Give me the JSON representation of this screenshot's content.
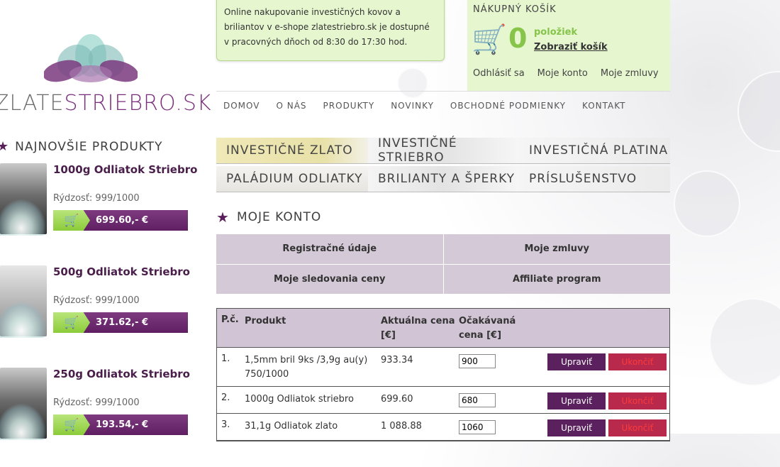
{
  "logo": {
    "prefix": "ZLATE",
    "suffix": "STRIEBRO.SK"
  },
  "notice": {
    "text": "Online nakupovanie investičných kovov a briliantov v e-shope zlatestriebro.sk je dostupné v pracovných dňoch od 8:30 do 17:30 hod."
  },
  "cart": {
    "title": "NÁKUPNÝ KOŠÍK",
    "count": "0",
    "items_label": "položiek",
    "view_label": "Zobraziť košík",
    "links": [
      "Odhlásiť sa",
      "Moje konto",
      "Moje zmluvy"
    ]
  },
  "nav": [
    "DOMOV",
    "O NÁS",
    "PRODUKTY",
    "NOVINKY",
    "OBCHODNÉ PODMIENKY",
    "KONTAKT"
  ],
  "categories": {
    "row1": [
      "INVESTIČNÉ ZLATO",
      "INVESTIČNÉ STRIEBRO",
      "INVESTIČNÁ PLATINA"
    ],
    "row2": [
      "PALÁDIUM ODLIATKY",
      "BRILIANTY A ŠPERKY",
      "PRÍSLUŠENSTVO"
    ]
  },
  "sidebar": {
    "heading": "NAJNOVŠIE PRODUKTY",
    "products": [
      {
        "name": "1000g Odliatok Striebro",
        "purity": "Rýdzosť: 999/1000",
        "price": "699.60,- €"
      },
      {
        "name": "500g Odliatok Striebro",
        "purity": "Rýdzosť: 999/1000",
        "price": "371.62,- €"
      },
      {
        "name": "250g Odliatok Striebro",
        "purity": "Rýdzosť: 999/1000",
        "price": "193.54,- €"
      }
    ]
  },
  "account": {
    "title": "MOJE KONTO",
    "menu": [
      "Registračné údaje",
      "Moje zmluvy",
      "Moje sledovania ceny",
      "Affiliate program"
    ]
  },
  "table": {
    "headers": {
      "no": "P.č.",
      "product": "Produkt",
      "current": "Aktuálna cena [€]",
      "expected": "Očakávaná cena [€]"
    },
    "rows": [
      {
        "no": "1.",
        "product": "1,5mm bril 9ks /3,9g au(y) 750/1000",
        "current": "933.34",
        "expected": "900"
      },
      {
        "no": "2.",
        "product": "1000g Odliatok striebro",
        "current": "699.60",
        "expected": "680"
      },
      {
        "no": "3.",
        "product": "31,1g Odliatok zlato",
        "current": "1 088.88",
        "expected": "1060"
      }
    ],
    "update_label": "Upraviť",
    "end_label": "Ukončiť"
  }
}
